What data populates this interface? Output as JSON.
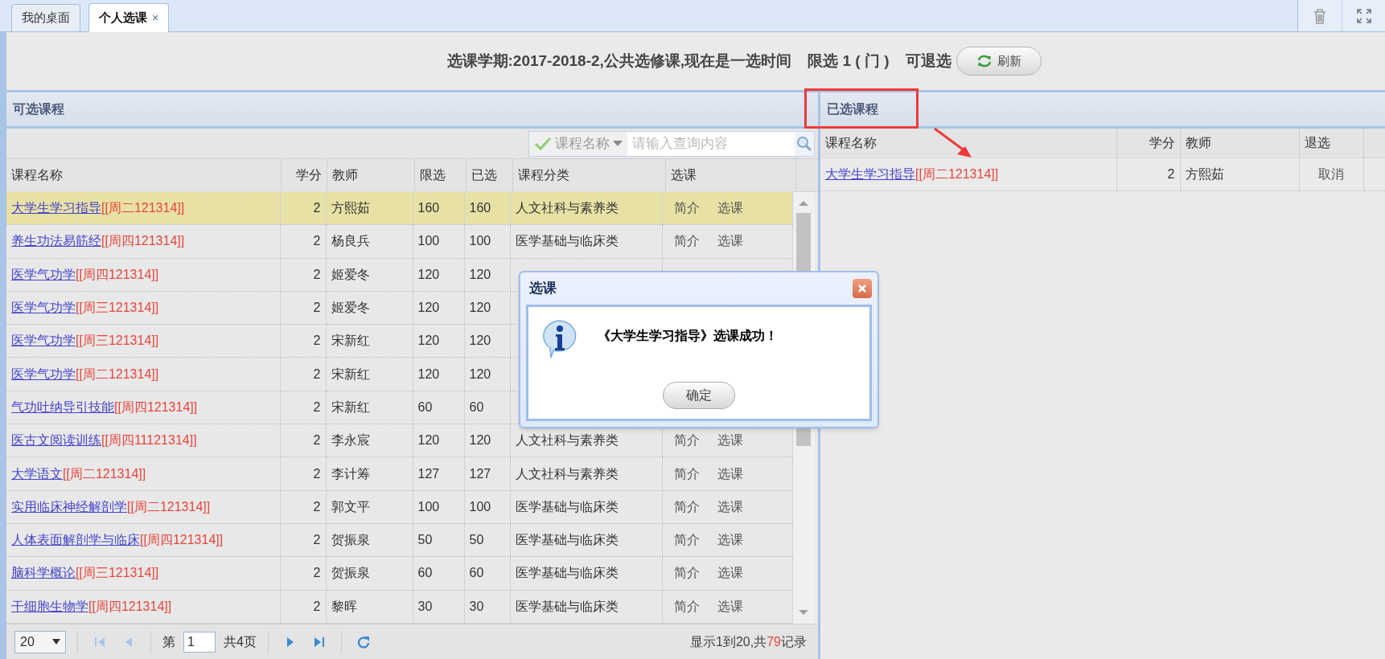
{
  "tabs": [
    {
      "label": "我的桌面",
      "selected": false
    },
    {
      "label": "个人选课",
      "selected": true,
      "close": "×"
    }
  ],
  "header": {
    "info": "选课学期:2017-2018-2,公共选修课,现在是一选时间",
    "limit": "限选 1 ( 门 )",
    "withdraw": "可退选",
    "refresh_button": "刷新"
  },
  "available": {
    "title": "可选课程",
    "search": {
      "field": "课程名称",
      "placeholder": "请输入查询内容"
    },
    "columns": [
      "课程名称",
      "学分",
      "教师",
      "限选",
      "已选",
      "课程分类",
      "选课"
    ],
    "rows": [
      {
        "name": "大学生学习指导",
        "time": "[[周二121314]]",
        "credit": "2",
        "teacher": "方熙茹",
        "limit": "160",
        "chosen": "160",
        "category": "人文社科与素养类",
        "actions": [
          "简介",
          "选课"
        ],
        "selected": true
      },
      {
        "name": "养生功法易筋经",
        "time": "[[周四121314]]",
        "credit": "2",
        "teacher": "杨良兵",
        "limit": "100",
        "chosen": "100",
        "category": "医学基础与临床类",
        "actions": [
          "简介",
          "选课"
        ],
        "selected": false
      },
      {
        "name": "医学气功学",
        "time": "[[周四121314]]",
        "credit": "2",
        "teacher": "姬爱冬",
        "limit": "120",
        "chosen": "120",
        "selected": false
      },
      {
        "name": "医学气功学",
        "time": "[[周三121314]]",
        "credit": "2",
        "teacher": "姬爱冬",
        "limit": "120",
        "chosen": "120",
        "selected": false
      },
      {
        "name": "医学气功学",
        "time": "[[周三121314]]",
        "credit": "2",
        "teacher": "宋新红",
        "limit": "120",
        "chosen": "120",
        "selected": false
      },
      {
        "name": "医学气功学",
        "time": "[[周二121314]]",
        "credit": "2",
        "teacher": "宋新红",
        "limit": "120",
        "chosen": "120",
        "selected": false
      },
      {
        "name": "气功吐纳导引技能",
        "time": "[[周四121314]]",
        "credit": "2",
        "teacher": "宋新红",
        "limit": "60",
        "chosen": "60",
        "selected": false
      },
      {
        "name": "医古文阅读训练",
        "time": "[[周四11121314]]",
        "credit": "2",
        "teacher": "李永宸",
        "limit": "120",
        "chosen": "120",
        "category": "人文社科与素养类",
        "actions": [
          "简介",
          "选课"
        ],
        "selected": false
      },
      {
        "name": "大学语文",
        "time": "[[周二121314]]",
        "credit": "2",
        "teacher": "李计筹",
        "limit": "127",
        "chosen": "127",
        "category": "人文社科与素养类",
        "actions": [
          "简介",
          "选课"
        ],
        "selected": false
      },
      {
        "name": "实用临床神经解剖学",
        "time": "[[周二121314]]",
        "credit": "2",
        "teacher": "郭文平",
        "limit": "100",
        "chosen": "100",
        "category": "医学基础与临床类",
        "actions": [
          "简介",
          "选课"
        ],
        "selected": false
      },
      {
        "name": "人体表面解剖学与临床",
        "time": "[[周四121314]]",
        "credit": "2",
        "teacher": "贺振泉",
        "limit": "50",
        "chosen": "50",
        "category": "医学基础与临床类",
        "actions": [
          "简介",
          "选课"
        ],
        "selected": false
      },
      {
        "name": "脑科学概论",
        "time": "[[周三121314]]",
        "credit": "2",
        "teacher": "贺振泉",
        "limit": "60",
        "chosen": "60",
        "category": "医学基础与临床类",
        "actions": [
          "简介",
          "选课"
        ],
        "selected": false
      },
      {
        "name": "干细胞生物学",
        "time": "[[周四121314]]",
        "credit": "2",
        "teacher": "黎晖",
        "limit": "30",
        "chosen": "30",
        "category": "医学基础与临床类",
        "actions": [
          "简介",
          "选课"
        ],
        "selected": false
      }
    ],
    "pager": {
      "page_size": "20",
      "page_label": "第",
      "page": "1",
      "total_pages": "共4页",
      "summary": "显示1到20,共",
      "total": "79",
      "summary_end": "记录"
    }
  },
  "chosen": {
    "title": "已选课程",
    "columns": [
      "课程名称",
      "学分",
      "教师",
      "退选"
    ],
    "rows": [
      {
        "name": "大学生学习指导",
        "time": "[[周二121314]]",
        "credit": "2",
        "teacher": "方熙茹",
        "action": "取消"
      }
    ]
  },
  "dialog": {
    "title": "选课",
    "message": "《大学生学习指导》选课成功！",
    "button": "确定"
  }
}
